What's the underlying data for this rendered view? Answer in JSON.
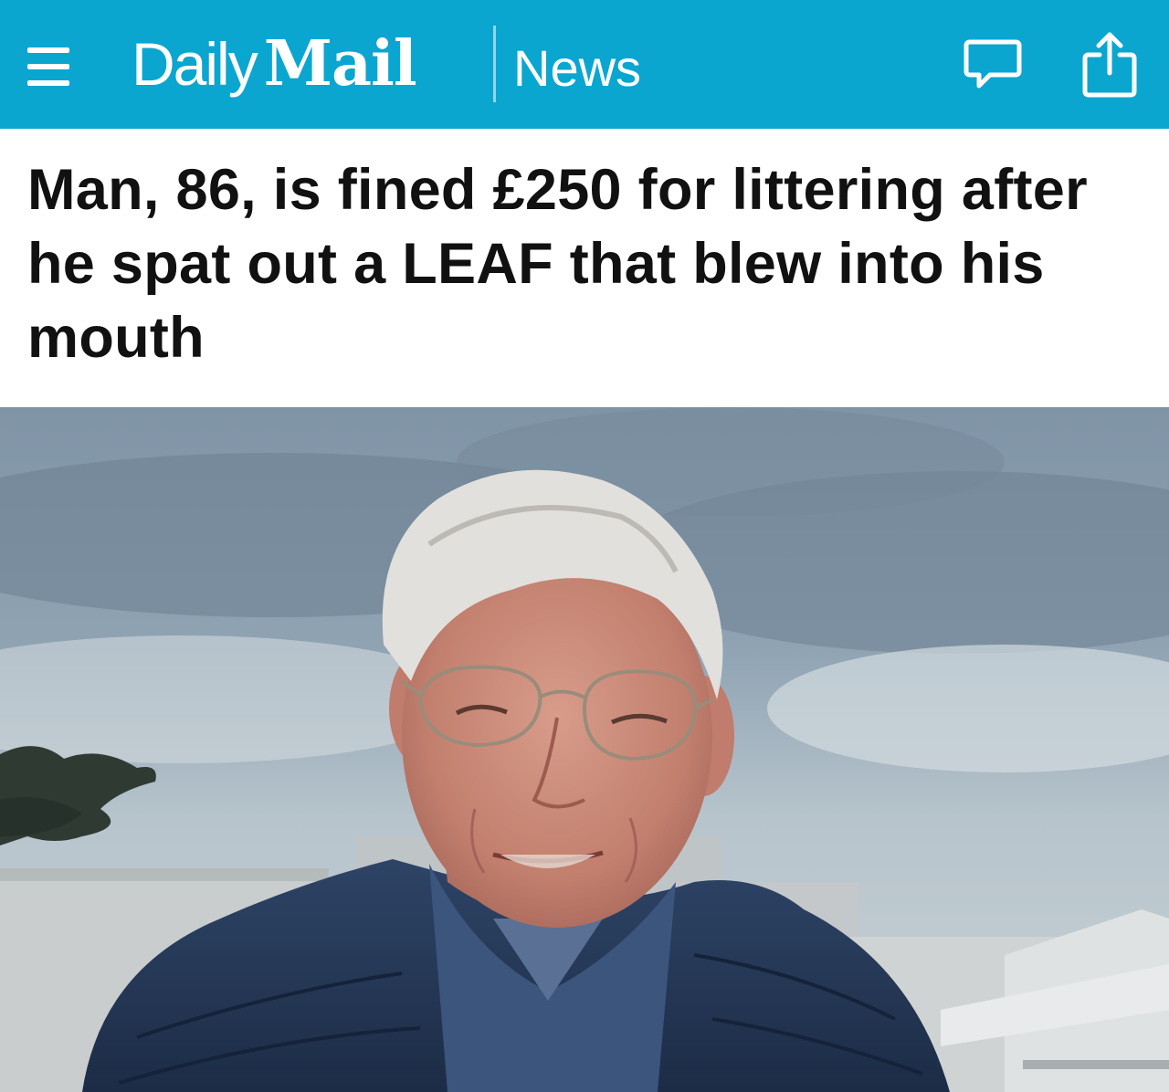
{
  "header": {
    "brand_daily": "Daily",
    "brand_mail": "Mail",
    "section": "News",
    "menu_icon": "hamburger-menu-icon",
    "comments_icon": "comment-bubble-icon",
    "share_icon": "share-icon",
    "bar_color": "#0aa6d0"
  },
  "article": {
    "headline": "Man, 86, is fined £250 for littering after he spat out a LEAF that blew into his mouth"
  }
}
